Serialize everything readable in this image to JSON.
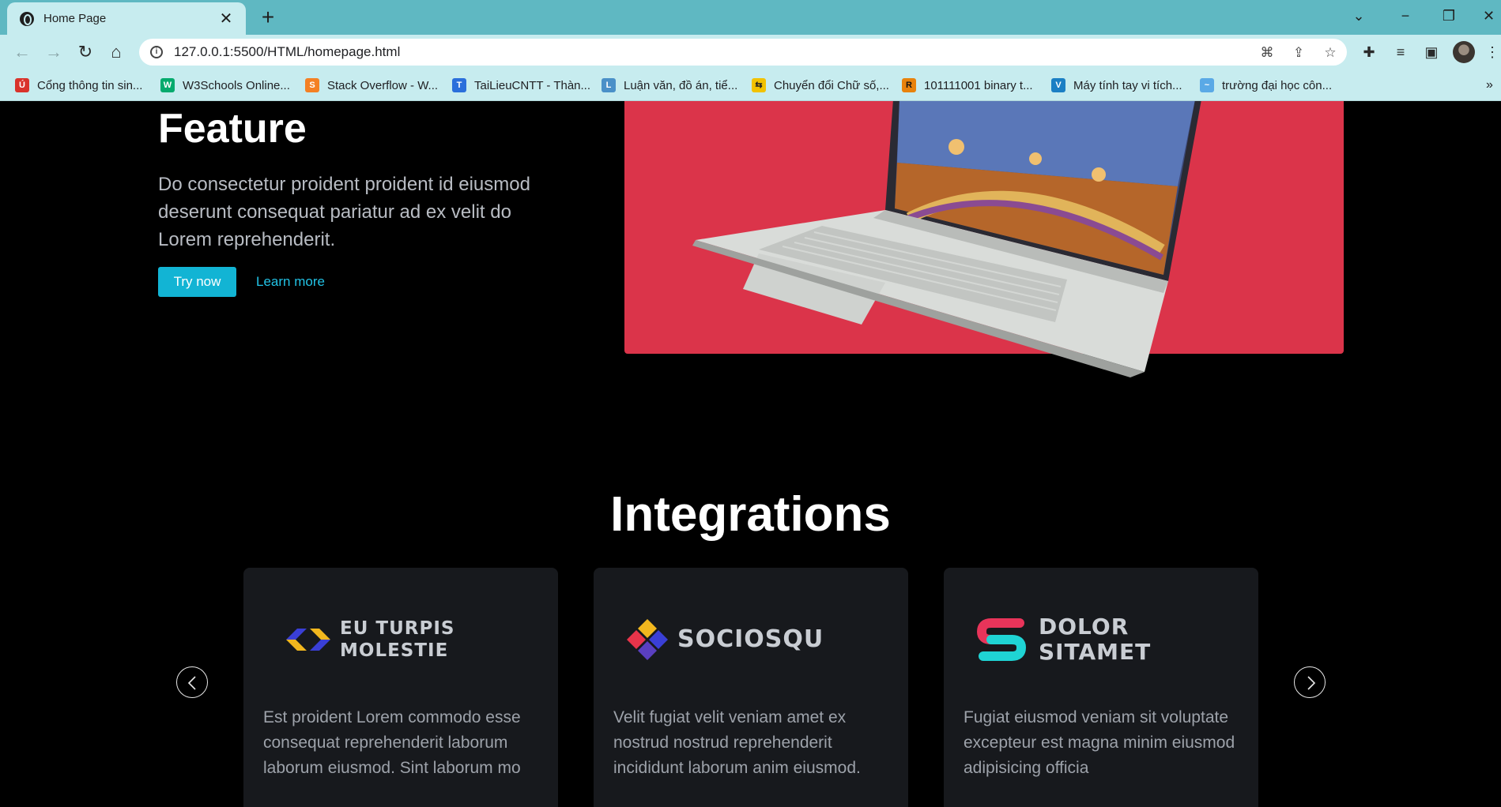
{
  "browser": {
    "tab_title": "Home Page",
    "url": "127.0.0.1:5500/HTML/homepage.html",
    "bookmarks": [
      {
        "label": "Cổng thông tin sin...",
        "icon": "university-icon",
        "color": "#d9332b"
      },
      {
        "label": "W3Schools Online...",
        "icon": "w3schools-icon",
        "color": "#04aa6d"
      },
      {
        "label": "Stack Overflow - W...",
        "icon": "stackoverflow-icon",
        "color": "#f48024"
      },
      {
        "label": "TaiLieuCNTT - Thàn...",
        "icon": "tailieucntt-icon",
        "color": "#2a6fdb"
      },
      {
        "label": "Luận văn, đồ án, tiể...",
        "icon": "document-icon",
        "color": "#4a90c8"
      },
      {
        "label": "Chuyển đổi Chữ số,...",
        "icon": "converter-icon",
        "color": "#f2c200"
      },
      {
        "label": "101111001 binary t...",
        "icon": "r-letter-icon",
        "color": "#e8820c"
      },
      {
        "label": "Máy tính tay vi tích...",
        "icon": "calculator-icon",
        "color": "#1b7fc4"
      },
      {
        "label": "trường đại học côn...",
        "icon": "wave-icon",
        "color": "#5aa9e6"
      }
    ]
  },
  "feature": {
    "title": "Feature",
    "text": "Do consectetur proident proident id eiusmod deserunt consequat pariatur ad ex velit do Lorem reprehenderit.",
    "try_label": "Try now",
    "learn_label": "Learn more"
  },
  "integrations": {
    "title": "Integrations",
    "cards": [
      {
        "logo_line1": "EU TURPIS",
        "logo_line2": "MOLESTIE",
        "desc": "Est proident Lorem commodo esse consequat reprehenderit laborum laborum eiusmod. Sint laborum mo"
      },
      {
        "logo_line1": "SOCIOSQU",
        "logo_line2": "",
        "desc": "Velit fugiat velit veniam amet ex nostrud nostrud reprehenderit incididunt laborum anim eiusmod."
      },
      {
        "logo_line1": "DOLOR",
        "logo_line2": "SITAMET",
        "desc": "Fugiat eiusmod veniam sit voluptate excepteur est magna minim eiusmod adipisicing officia"
      }
    ]
  },
  "colors": {
    "accent": "#12b4d4",
    "hero_bg": "#db344a",
    "card_bg": "#17191d",
    "chrome": "#c7ecef"
  }
}
